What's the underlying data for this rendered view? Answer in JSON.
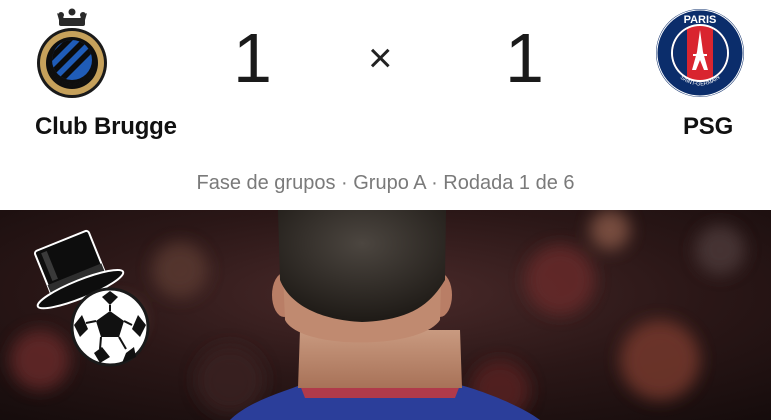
{
  "match": {
    "home_team": "Club Brugge",
    "away_team": "PSG",
    "home_score": "1",
    "away_score": "1",
    "separator": "×",
    "info": "Fase de grupos · Grupo A · Rodada 1 de 6"
  },
  "crests": {
    "home_text": "CLUB BRUGGE K.V.",
    "away_text_top": "PARIS",
    "away_text_bottom": "SAINT-GERMAIN"
  },
  "colors": {
    "brugge_blue": "#1f5cb8",
    "brugge_gold": "#c6a15b",
    "psg_navy": "#0b2d6b",
    "psg_red": "#d9252f",
    "info_text": "#7a7a7a"
  },
  "icons": {
    "sticker": "top-hat-soccer-ball-icon"
  }
}
